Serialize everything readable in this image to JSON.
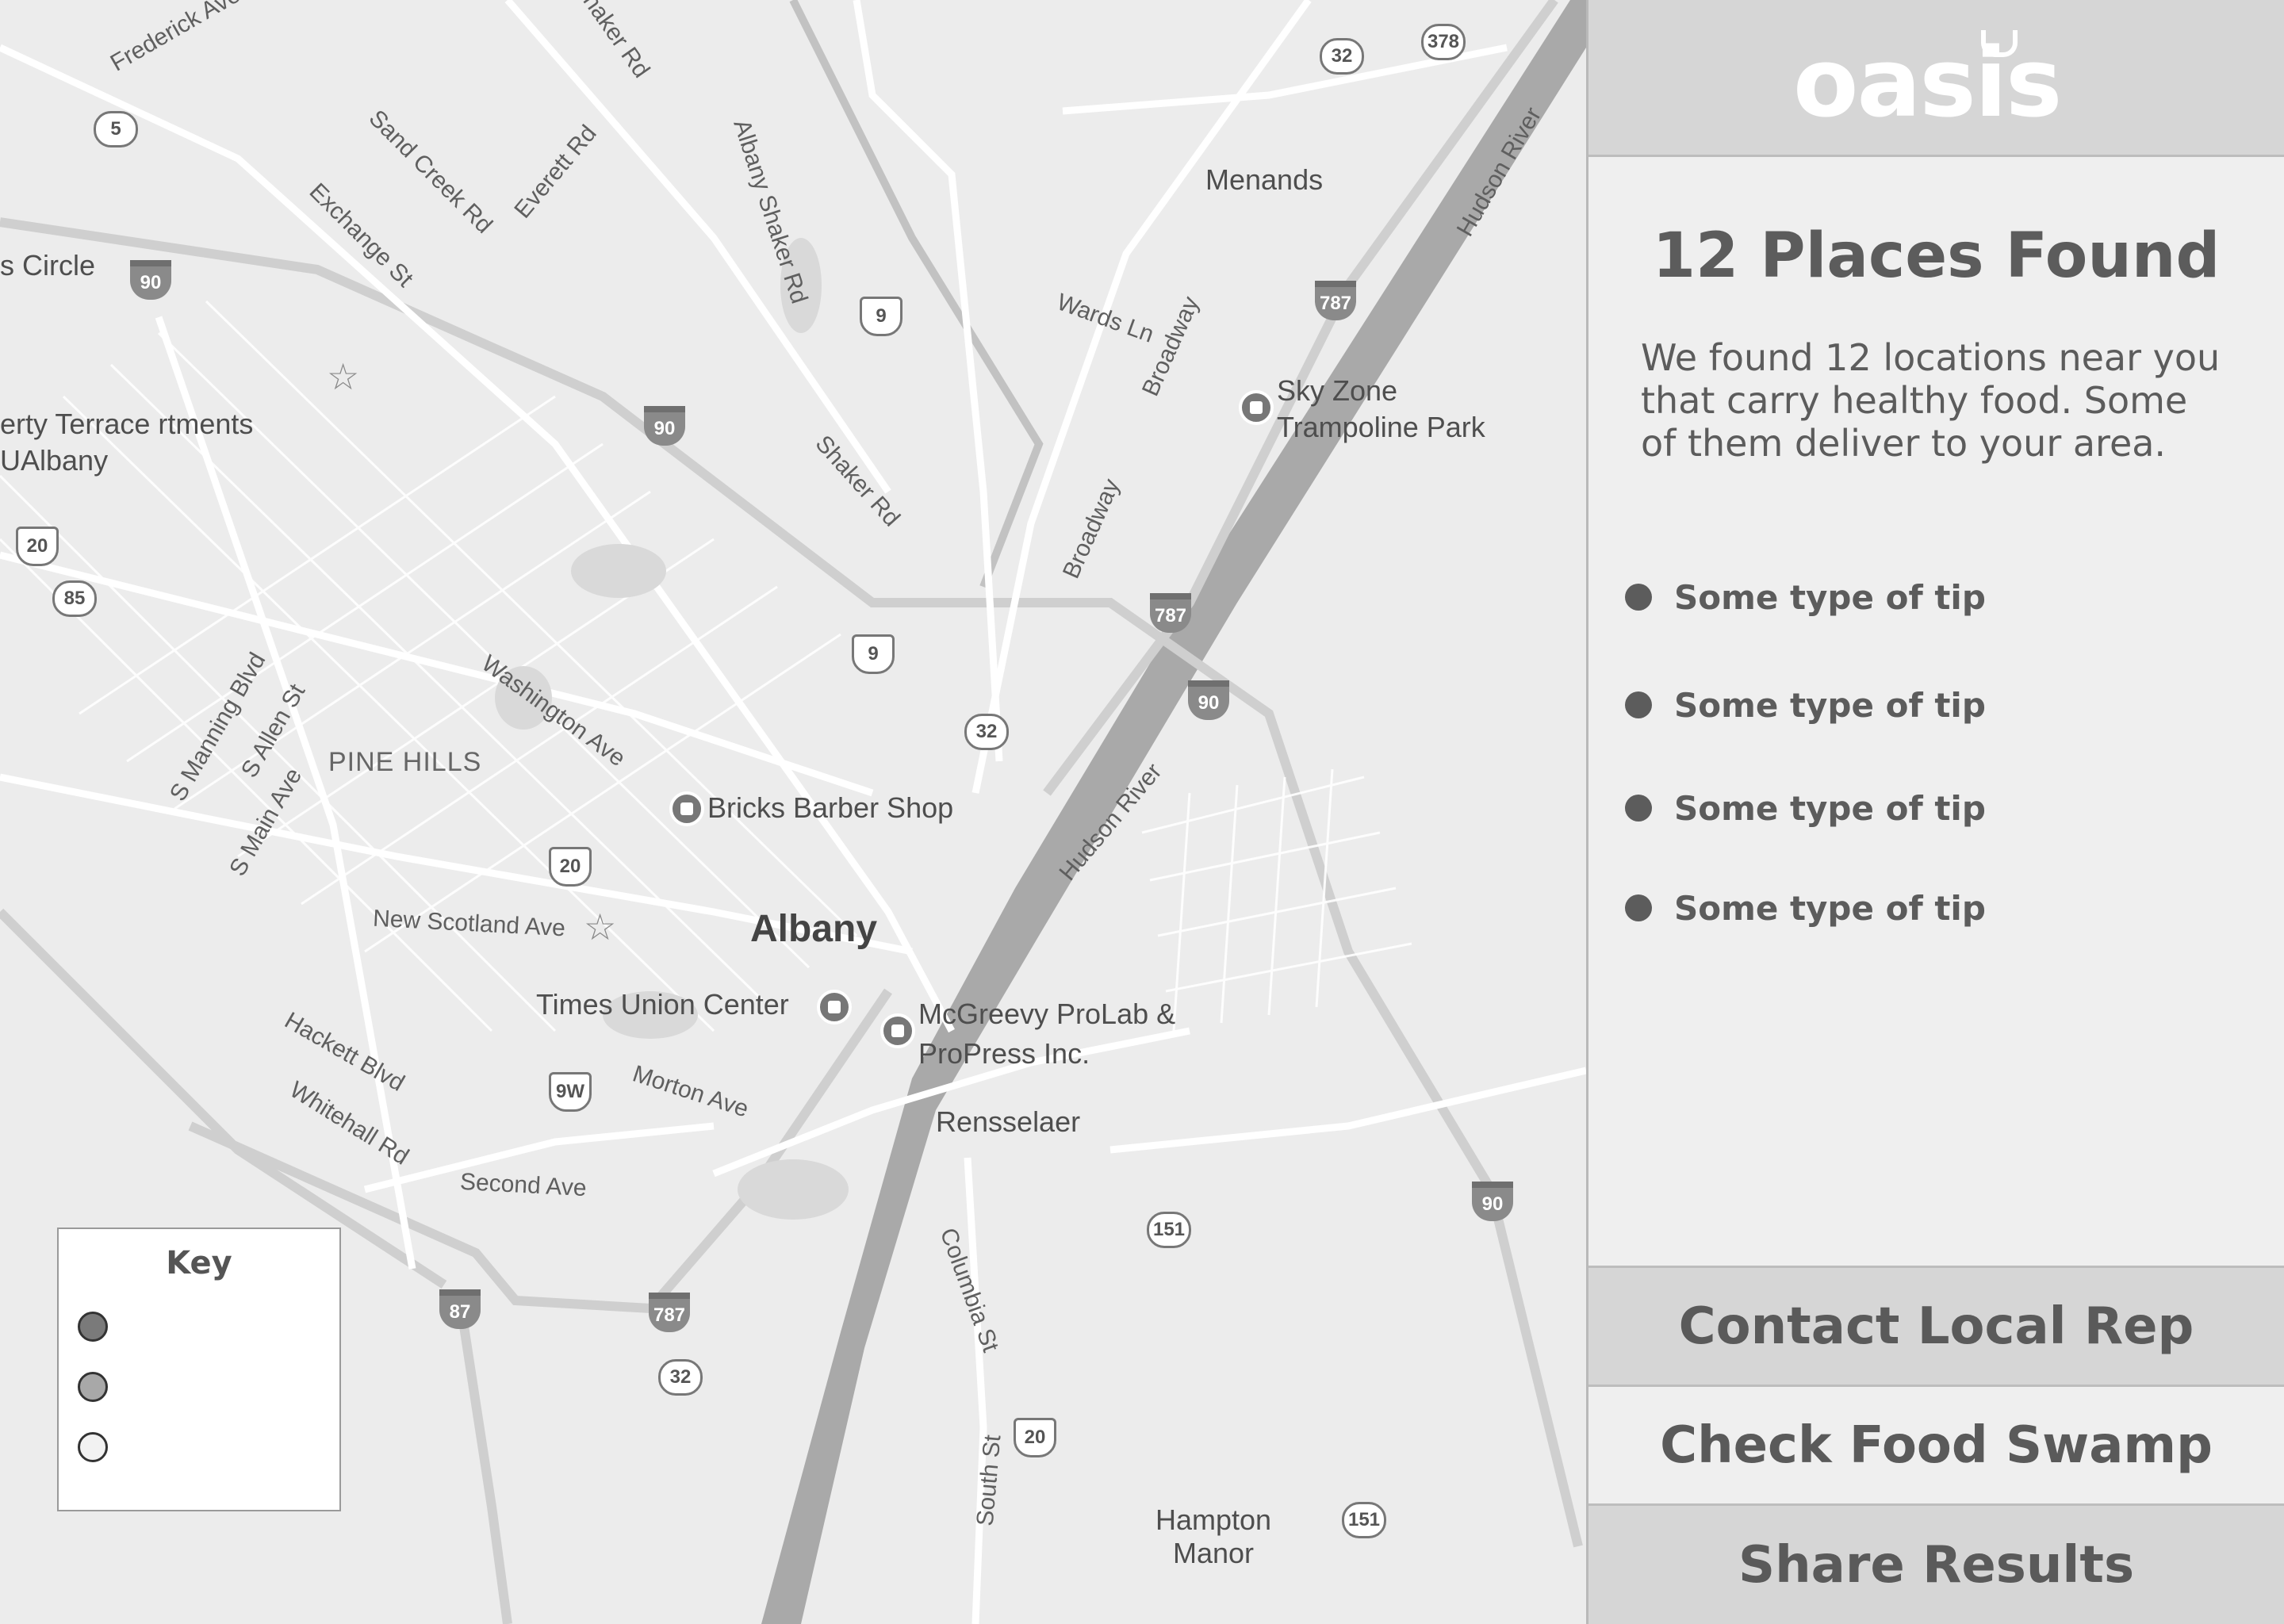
{
  "map": {
    "city_label": "Albany",
    "neighborhood_label": "PINE HILLS",
    "place_labels": [
      "Menands",
      "Rensselaer",
      "Hampton Manor",
      "Times Union Center",
      "Bricks Barber Shop",
      "McGreevy ProLab & ProPress Inc.",
      "Sky Zone Trampoline Park",
      "erty Terrace rtments UAlbany",
      "s Circle"
    ],
    "road_labels": [
      "Frederick Ave",
      "Shaker Rd",
      "Sand Creek Rd",
      "Everett Rd",
      "Exchange St",
      "Albany Shaker Rd",
      "Wards Ln",
      "Broadway",
      "Broadway",
      "Shaker Rd",
      "Washington Ave",
      "S Manning Blvd",
      "S Allen St",
      "S Main Ave",
      "New Scotland Ave",
      "Hackett Blvd",
      "Whitehall Rd",
      "Morton Ave",
      "Second Ave",
      "Columbia St",
      "South St",
      "Hudson River",
      "Hudson River"
    ],
    "shields": [
      "5",
      "90",
      "90",
      "20",
      "85",
      "32",
      "378",
      "9",
      "787",
      "787",
      "90",
      "9",
      "32",
      "20",
      "9W",
      "87",
      "787",
      "32",
      "151",
      "20",
      "151",
      "90"
    ]
  },
  "key": {
    "title": "Key",
    "colors": [
      "#7a7a7a",
      "#a8a8a8",
      "#f2f2f2"
    ]
  },
  "panel": {
    "logo_text": "oasis",
    "heading": "12 Places Found",
    "description": "We found 12 locations near you that carry healthy food. Some of them deliver to your area.",
    "tips": [
      "Some type of tip",
      "Some type of tip",
      "Some type of tip",
      "Some type of tip"
    ],
    "buttons": {
      "contact": "Contact Local Rep",
      "check": "Check Food Swamp",
      "share": "Share Results"
    }
  },
  "colors": {
    "accent": "#5c5c5c",
    "panel_bg": "#efefef",
    "map_bg": "#ececec"
  }
}
